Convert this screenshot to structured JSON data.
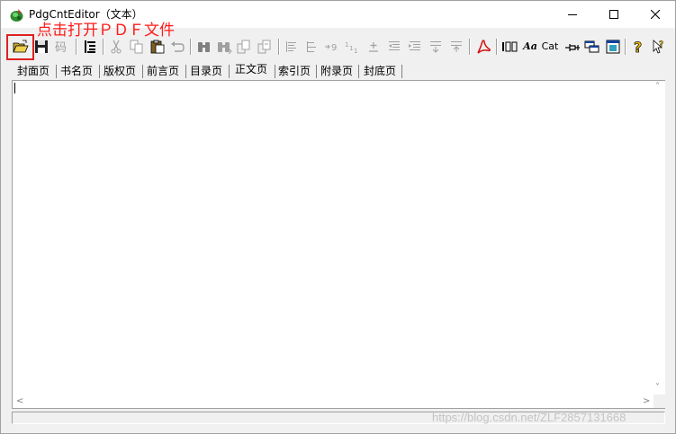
{
  "window": {
    "title": "PdgCntEditor（文本）"
  },
  "annotation": {
    "text": "点击打开ＰＤＦ文件",
    "color": "#e02020"
  },
  "toolbar": {
    "text_buttons": {
      "char_set": "Aa",
      "catalog": "Cat"
    },
    "icons": [
      "open-folder-icon",
      "save-icon",
      "encode-icon",
      "outline-icon",
      "cut-icon",
      "copy-icon",
      "paste-icon",
      "undo-icon",
      "find-icon",
      "find-next-icon",
      "replace-icon",
      "replace-next-icon",
      "align-left-icon",
      "align-tree-icon",
      "indent-number-icon",
      "numbering-icon",
      "level-plus-minus-icon",
      "outdent-icon",
      "indent-icon",
      "move-down-icon",
      "move-up-icon",
      "pdf-icon",
      "page-range-icon",
      "font-icon",
      "catalog-icon",
      "pin-icon",
      "window-icon",
      "export-icon",
      "help-icon",
      "context-help-icon"
    ]
  },
  "tabs": [
    {
      "label": "封面页"
    },
    {
      "label": "书名页"
    },
    {
      "label": "版权页"
    },
    {
      "label": "前言页"
    },
    {
      "label": "目录页"
    },
    {
      "label": "正文页",
      "active": true
    },
    {
      "label": "索引页"
    },
    {
      "label": "附录页"
    },
    {
      "label": "封底页"
    }
  ],
  "editor": {
    "content": ""
  },
  "scrollbar": {
    "up": "˄",
    "down": "˅",
    "left": "<",
    "right": ">"
  },
  "watermark": "https://blog.csdn.net/ZLF2857131668"
}
